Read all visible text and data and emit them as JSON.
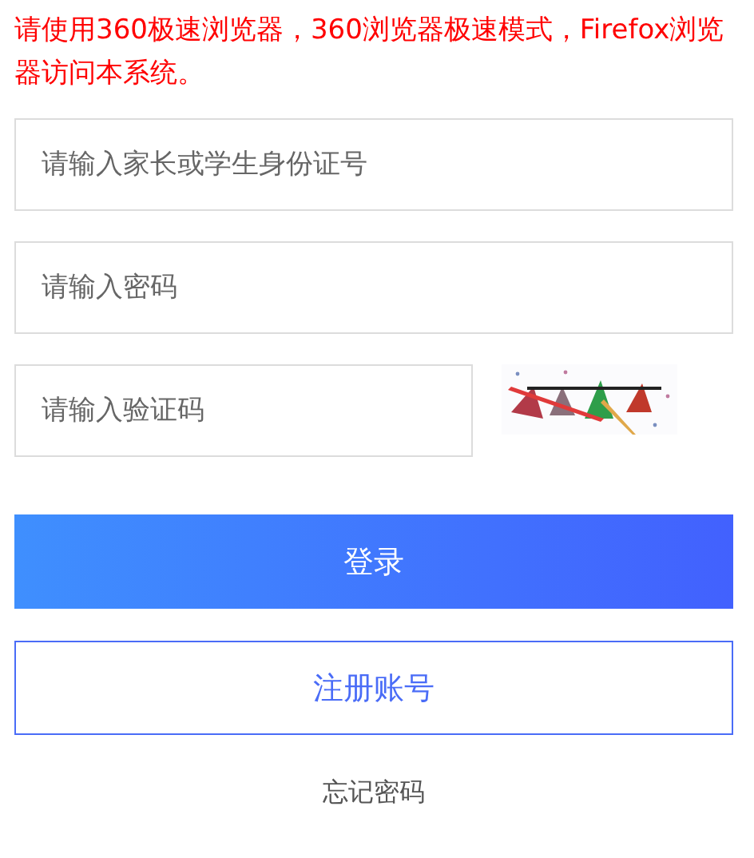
{
  "notice": "请使用360极速浏览器，360浏览器极速模式，Firefox浏览器访问本系统。",
  "fields": [
    {
      "kind": "text",
      "placeholder": "请输入家长或学生身份证号"
    },
    {
      "kind": "password",
      "placeholder": "请输入密码"
    },
    {
      "kind": "captcha",
      "placeholder": "请输入验证码"
    }
  ],
  "login_button": "登录",
  "register_button": "注册账号",
  "forgot_link": "忘记密码"
}
